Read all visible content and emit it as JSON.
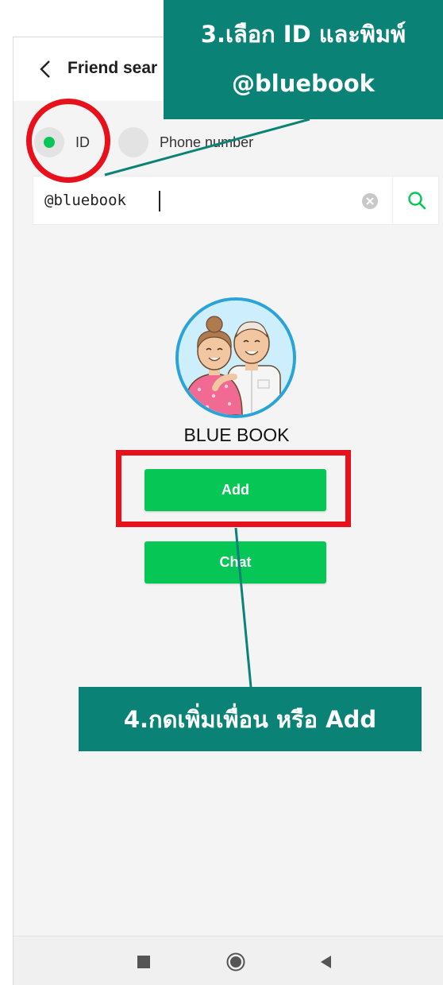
{
  "appbar": {
    "title": "Friend sear"
  },
  "search_type": {
    "options": [
      {
        "label": "ID",
        "selected": true
      },
      {
        "label": "Phone number",
        "selected": false
      }
    ]
  },
  "search": {
    "value": "@bluebook"
  },
  "profile": {
    "name": "BLUE BOOK",
    "add_label": "Add",
    "chat_label": "Chat"
  },
  "annotations": {
    "step3_line1": "3.เลือก ID และพิมพ์",
    "step3_line2": "@bluebook",
    "step4": "4.กดเพิ่มเพื่อน หรือ Add"
  },
  "colors": {
    "accent": "#06c755",
    "callout": "#0b8276",
    "highlight": "#e8101b"
  },
  "icons": [
    "back-chevron-icon",
    "clear-icon",
    "search-icon",
    "nav-recents-icon",
    "nav-home-icon",
    "nav-back-icon"
  ]
}
